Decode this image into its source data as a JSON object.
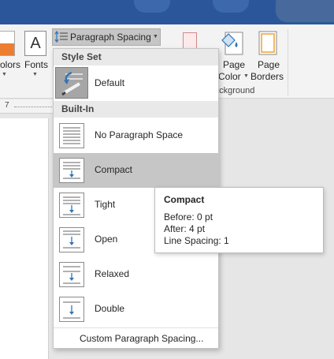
{
  "ribbon": {
    "colors_label": "olors",
    "fonts_label": "Fonts",
    "paragraph_spacing_label": "Paragraph Spacing",
    "page_color_line1": "Page",
    "page_color_line2": "Color",
    "page_borders_line1": "Page",
    "page_borders_line2": "Borders",
    "group_label": "ackground",
    "fonts_icon_glyph": "A"
  },
  "ruler": {
    "mark": "7"
  },
  "dropdown": {
    "style_set_header": "Style Set",
    "default_label": "Default",
    "builtin_header": "Built-In",
    "items": [
      {
        "label": "No Paragraph Space"
      },
      {
        "label": "Compact"
      },
      {
        "label": "Tight"
      },
      {
        "label": "Open"
      },
      {
        "label": "Relaxed"
      },
      {
        "label": "Double"
      }
    ],
    "selected_item": "Compact",
    "footer": "Custom Paragraph Spacing..."
  },
  "tooltip": {
    "title": "Compact",
    "lines": [
      "Before: 0 pt",
      "After: 4 pt",
      "Line Spacing: 1"
    ]
  },
  "colors": {
    "title_bar": "#2b579a",
    "selected_item": "#c6c6c6",
    "arrow_blue": "#2e75b6",
    "orange_swatch": "#ed7d31"
  }
}
